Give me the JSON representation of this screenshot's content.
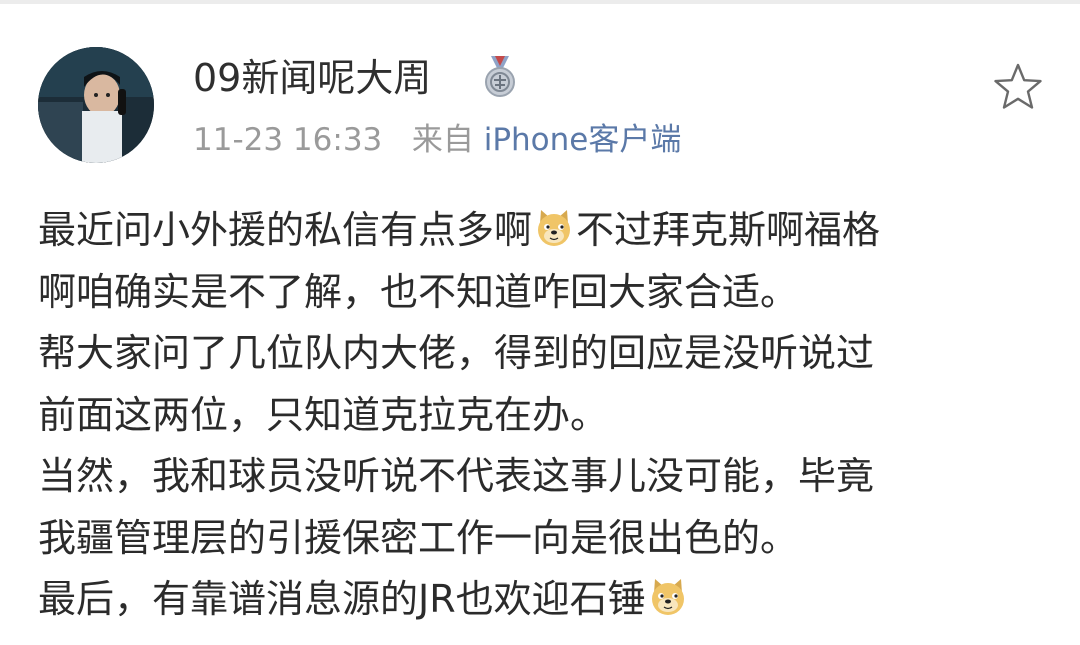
{
  "post": {
    "author": "09新闻呢大周",
    "badge_icon": "medal-badge-icon",
    "timestamp": "11-23 16:33",
    "source_prefix": "来自",
    "source": "iPhone客户端",
    "favorite_icon": "star-outline-icon",
    "emoji_icon": "doge-emoji-icon",
    "lines": [
      {
        "pre": "最近问小外援的私信有点多啊",
        "post": "不过拜克斯啊福格"
      },
      {
        "pre": "啊咱确实是不了解，也不知道咋回大家合适。"
      },
      {
        "pre": "帮大家问了几位队内大佬，得到的回应是没听说过"
      },
      {
        "pre": "前面这两位，只知道克拉克在办。"
      },
      {
        "pre": "当然，我和球员没听说不代表这事儿没可能，毕竟"
      },
      {
        "pre": "我疆管理层的引援保密工作一向是很出色的。"
      },
      {
        "pre": "最后，有靠谱消息源的JR也欢迎石锤"
      }
    ]
  }
}
